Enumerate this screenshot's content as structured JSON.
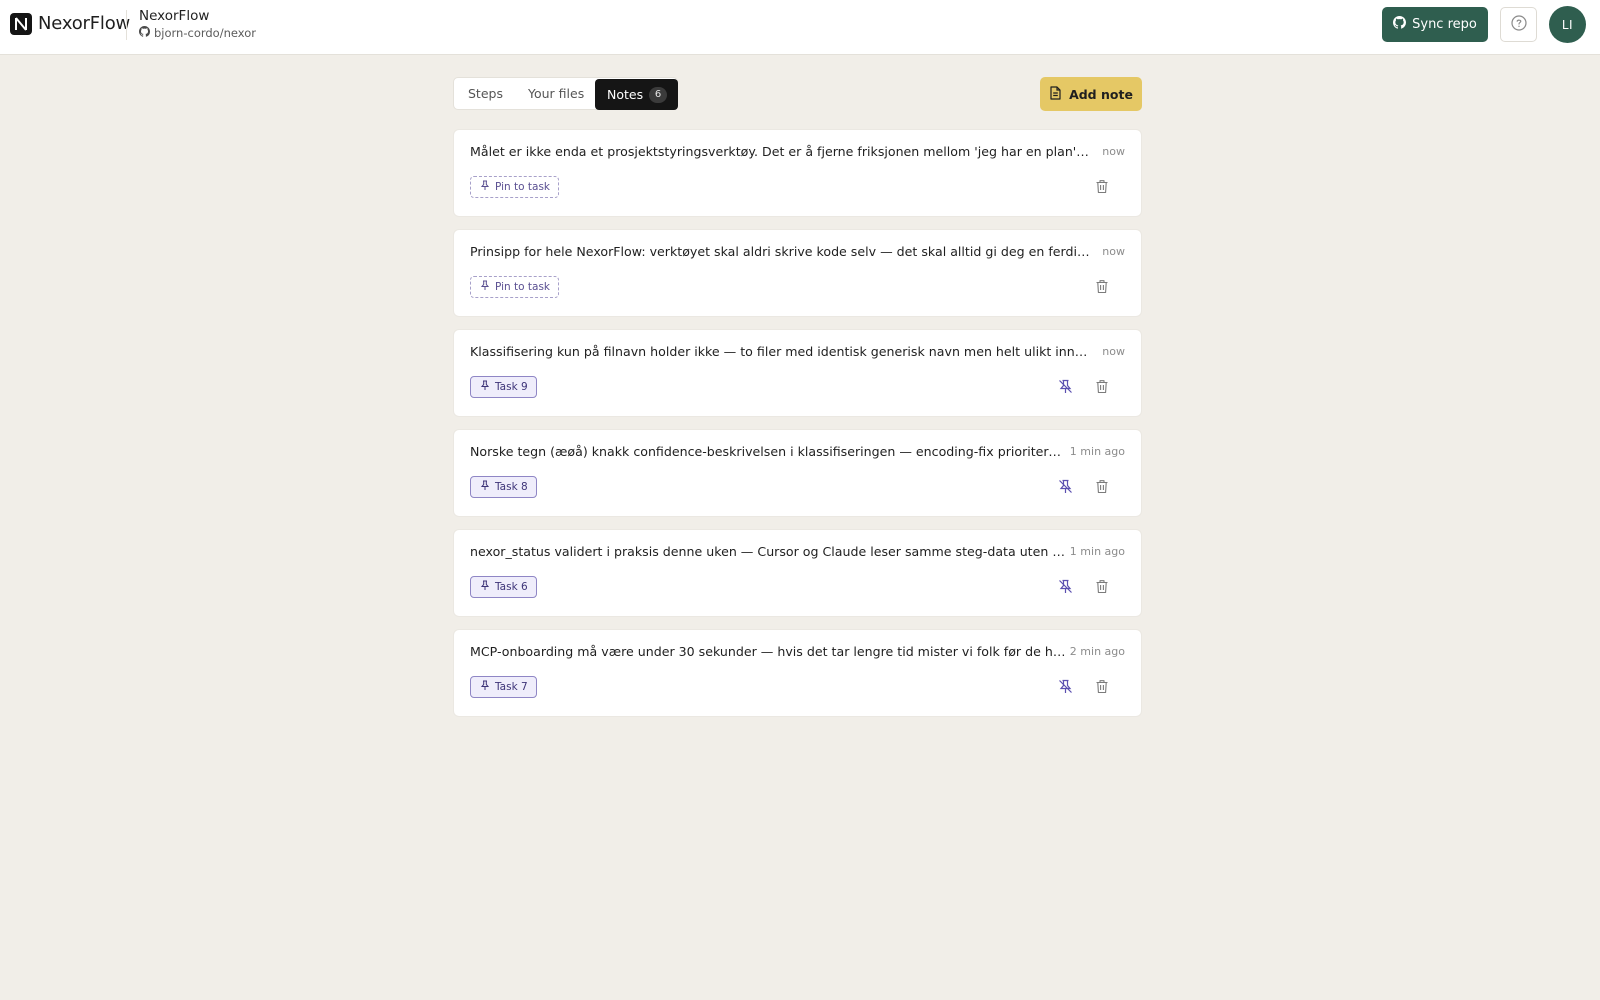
{
  "header": {
    "app_name": "NexorFlow",
    "project_name": "NexorFlow",
    "repo": "bjorn-cordo/nexor",
    "sync_label": "Sync repo",
    "avatar_initials": "LI"
  },
  "tabs": {
    "steps": "Steps",
    "files": "Your files",
    "notes": "Notes",
    "notes_count": "6"
  },
  "add_note_label": "Add note",
  "notes": [
    {
      "text": "Målet er ikke enda et prosjektstyringsverktøy. Det er å fjerne friksjonen mellom 'jeg har en plan' og 'je...",
      "time": "now",
      "chip": "Pin to task",
      "pinned": false
    },
    {
      "text": "Prinsipp for hele NexorFlow: verktøyet skal aldri skrive kode selv — det skal alltid gi deg en ferdig pro...",
      "time": "now",
      "chip": "Pin to task",
      "pinned": false
    },
    {
      "text": "Klassifisering kun på filnavn holder ikke — to filer med identisk generisk navn men helt ulikt innhold e...",
      "time": "now",
      "chip": "Task 9",
      "pinned": true
    },
    {
      "text": "Norske tegn (æøå) knakk confidence-beskrivelsen i klassifiseringen — encoding-fix prioriteres f...",
      "time": "1 min ago",
      "chip": "Task 8",
      "pinned": true
    },
    {
      "text": "nexor_status validert i praksis denne uken — Cursor og Claude leser samme steg-data uten ma...",
      "time": "1 min ago",
      "chip": "Task 6",
      "pinned": true
    },
    {
      "text": "MCP-onboarding må være under 30 sekunder — hvis det tar lengre tid mister vi folk før de har ...",
      "time": "2 min ago",
      "chip": "Task 7",
      "pinned": true
    }
  ],
  "colors": {
    "background": "#f1eee8",
    "primary_green": "#2f5e4f",
    "accent_yellow": "#e5c865",
    "chip_purple": "#5a4f91"
  }
}
